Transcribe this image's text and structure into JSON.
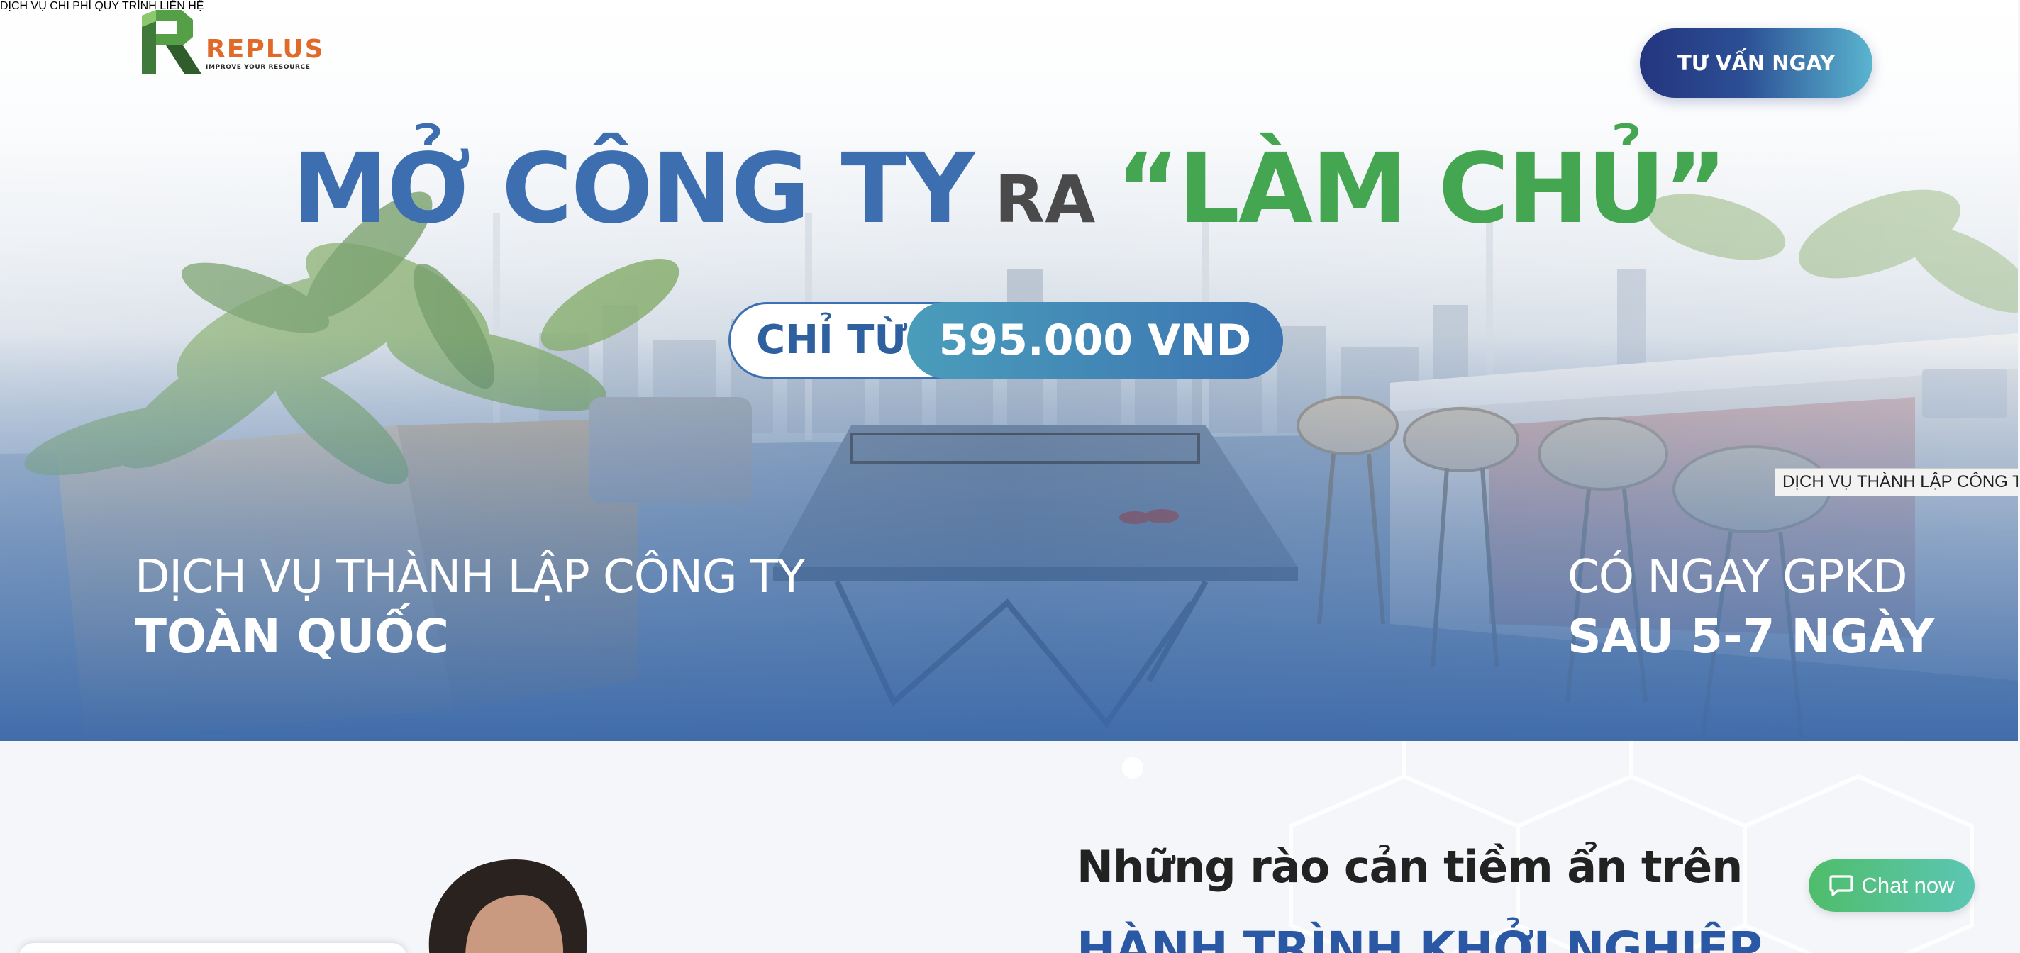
{
  "brand": {
    "name": "REPLUS",
    "tagline": "IMPROVE YOUR RESOURCE"
  },
  "nav": {
    "items": [
      {
        "label": "DỊCH VỤ"
      },
      {
        "label": "CHI PHÍ"
      },
      {
        "label": "QUY TRÌNH"
      },
      {
        "label": "LIÊN HỆ"
      }
    ],
    "cta_label": "TƯ VẤN NGAY"
  },
  "hero": {
    "headline_part1": "MỞ CÔNG TY",
    "headline_part2": "RA",
    "headline_part3": "“LÀM CHỦ”",
    "price_label": "CHỈ TỪ",
    "price_value": "595.000 VND",
    "left_line1": "DỊCH VỤ THÀNH LẬP CÔNG TY",
    "left_line2": "TOÀN QUỐC",
    "right_line1": "CÓ NGAY GPKD",
    "right_line2": "SAU 5-7 NGÀY",
    "tooltip": "DỊCH VỤ THÀNH LẬP CÔNG TY"
  },
  "section": {
    "title": "Những rào cản tiềm ẩn trên",
    "subtitle": "HÀNH TRÌNH KHỞI NGHIỆP"
  },
  "chat": {
    "label": "Chat now",
    "icon": "chat-bubble-icon"
  },
  "colors": {
    "brand_blue": "#2a58a4",
    "brand_green": "#44a650",
    "brand_orange": "#e06a2a",
    "cta_dark": "#24357f",
    "chat_green": "#4fbd6a"
  }
}
